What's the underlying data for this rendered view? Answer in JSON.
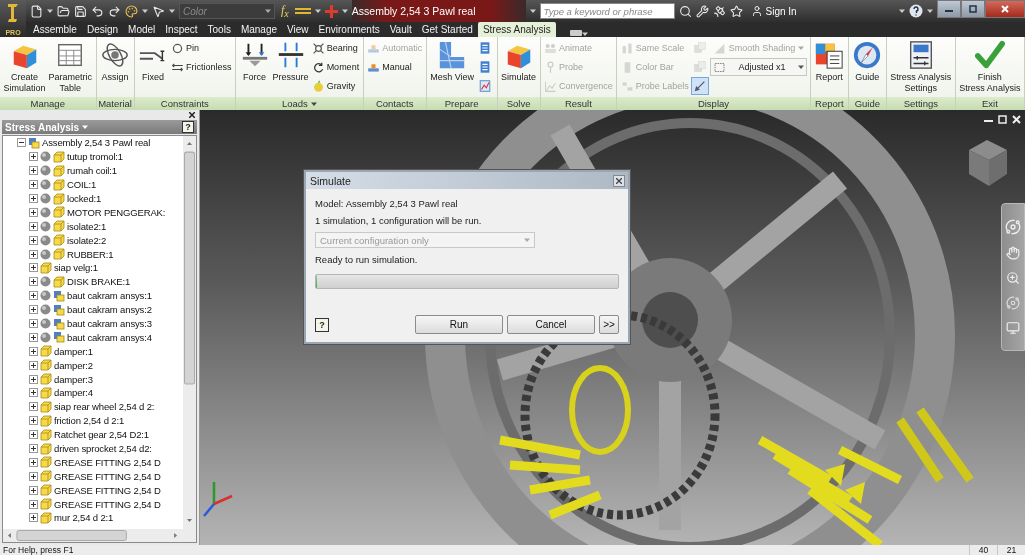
{
  "app_button": {
    "badge": "PRO"
  },
  "title_bar": {
    "style_value": "Color",
    "parameters_button": "f$_{x}$",
    "title": "Assembly 2,54 3 Pawl real",
    "search_placeholder": "Type a keyword or phrase",
    "sign_in": "Sign In"
  },
  "tabs": [
    {
      "label": "Assemble",
      "selected": false
    },
    {
      "label": "Design",
      "selected": false
    },
    {
      "label": "Model",
      "selected": false
    },
    {
      "label": "Inspect",
      "selected": false
    },
    {
      "label": "Tools",
      "selected": false
    },
    {
      "label": "Manage",
      "selected": false
    },
    {
      "label": "View",
      "selected": false
    },
    {
      "label": "Environments",
      "selected": false
    },
    {
      "label": "Vault",
      "selected": false
    },
    {
      "label": "Get Started",
      "selected": false
    },
    {
      "label": "Stress Analysis",
      "selected": true
    }
  ],
  "ribbon": {
    "panels": [
      {
        "label": "Manage",
        "menu": false,
        "columns": [
          [
            {
              "kind": "large",
              "label": "Create\nSimulation",
              "disabled": false
            }
          ],
          [
            {
              "kind": "large",
              "label": "Parametric\nTable",
              "disabled": false
            }
          ]
        ]
      },
      {
        "label": "Material",
        "menu": false,
        "columns": [
          [
            {
              "kind": "large",
              "label": "Assign",
              "disabled": false
            }
          ]
        ]
      },
      {
        "label": "Constraints",
        "menu": false,
        "columns": [
          [
            {
              "kind": "large",
              "label": "Fixed",
              "disabled": false
            }
          ],
          [
            {
              "kind": "small",
              "label": "Pin",
              "disabled": false
            },
            {
              "kind": "small",
              "label": "Frictionless",
              "disabled": false
            }
          ]
        ]
      },
      {
        "label": "Loads",
        "menu": true,
        "columns": [
          [
            {
              "kind": "large",
              "label": "Force",
              "disabled": false
            }
          ],
          [
            {
              "kind": "large",
              "label": "Pressure",
              "disabled": false
            }
          ],
          [
            {
              "kind": "small",
              "label": "Bearing",
              "disabled": false
            },
            {
              "kind": "small",
              "label": "Moment",
              "disabled": false
            },
            {
              "kind": "small",
              "label": "Gravity",
              "disabled": false
            }
          ]
        ]
      },
      {
        "label": "Contacts",
        "menu": false,
        "columns": [
          [
            {
              "kind": "small",
              "label": "Automatic",
              "disabled": true
            },
            {
              "kind": "small",
              "label": "Manual",
              "disabled": false
            }
          ]
        ]
      },
      {
        "label": "Prepare",
        "menu": false,
        "columns": [
          [
            {
              "kind": "large",
              "label": "Mesh View",
              "disabled": false
            }
          ],
          [
            {
              "kind": "icon",
              "selected": false,
              "disabled": false
            },
            {
              "kind": "icon",
              "selected": false,
              "disabled": false
            },
            {
              "kind": "icon",
              "selected": false,
              "disabled": false
            }
          ]
        ]
      },
      {
        "label": "Solve",
        "menu": false,
        "columns": [
          [
            {
              "kind": "large",
              "label": "Simulate",
              "disabled": false
            }
          ]
        ]
      },
      {
        "label": "Result",
        "menu": false,
        "columns": [
          [
            {
              "kind": "small",
              "label": "Animate",
              "disabled": true
            },
            {
              "kind": "small",
              "label": "Probe",
              "disabled": true
            },
            {
              "kind": "small",
              "label": "Convergence",
              "disabled": true
            }
          ]
        ]
      },
      {
        "label": "Display",
        "menu": false,
        "columns": [
          [
            {
              "kind": "small",
              "label": "Same Scale",
              "disabled": true
            },
            {
              "kind": "small",
              "label": "Color Bar",
              "disabled": true
            },
            {
              "kind": "small",
              "label": "Probe Labels",
              "disabled": true
            }
          ],
          [
            {
              "kind": "icon",
              "selected": false,
              "disabled": true
            },
            {
              "kind": "icon",
              "selected": false,
              "disabled": true
            },
            {
              "kind": "icon",
              "selected": true,
              "disabled": false
            }
          ],
          [
            {
              "kind": "select",
              "label": "Smooth Shading",
              "disabled": true
            },
            {
              "kind": "select",
              "label": "Adjusted x1",
              "disabled": false
            }
          ]
        ]
      },
      {
        "label": "Report",
        "menu": false,
        "columns": [
          [
            {
              "kind": "large",
              "label": "Report",
              "disabled": false
            }
          ]
        ]
      },
      {
        "label": "Guide",
        "menu": false,
        "columns": [
          [
            {
              "kind": "large",
              "label": "Guide",
              "disabled": false
            }
          ]
        ]
      },
      {
        "label": "Settings",
        "menu": false,
        "columns": [
          [
            {
              "kind": "large",
              "label": "Stress Analysis\nSettings",
              "disabled": false
            }
          ]
        ]
      },
      {
        "label": "Exit",
        "menu": false,
        "columns": [
          [
            {
              "kind": "large",
              "label": "Finish\nStress Analysis",
              "disabled": false
            }
          ]
        ]
      }
    ]
  },
  "browser": {
    "title": "Stress Analysis",
    "help": "?",
    "tree": {
      "label": "Assembly 2,54 3 Pawl real",
      "kind": "assembly",
      "expanded": true,
      "excluded": false,
      "children": [
        {
          "label": "tutup tromol:1",
          "kind": "part",
          "expanded": false,
          "excluded": true
        },
        {
          "label": "rumah coil:1",
          "kind": "part",
          "expanded": false,
          "excluded": true
        },
        {
          "label": "COIL:1",
          "kind": "part",
          "expanded": false,
          "excluded": true
        },
        {
          "label": "locked:1",
          "kind": "part",
          "expanded": false,
          "excluded": true
        },
        {
          "label": "MOTOR PENGGERAK:",
          "kind": "part",
          "expanded": false,
          "excluded": true
        },
        {
          "label": "isolate2:1",
          "kind": "part",
          "expanded": false,
          "excluded": true
        },
        {
          "label": "isolate2:2",
          "kind": "part",
          "expanded": false,
          "excluded": true
        },
        {
          "label": "RUBBER:1",
          "kind": "part",
          "expanded": false,
          "excluded": true
        },
        {
          "label": "siap velg:1",
          "kind": "part",
          "expanded": false,
          "excluded": false
        },
        {
          "label": "DISK BRAKE:1",
          "kind": "part",
          "expanded": false,
          "excluded": true
        },
        {
          "label": "baut cakram ansys:1",
          "kind": "assembly",
          "expanded": false,
          "excluded": true
        },
        {
          "label": "baut cakram ansys:2",
          "kind": "assembly",
          "expanded": false,
          "excluded": true
        },
        {
          "label": "baut cakram ansys:3",
          "kind": "assembly",
          "expanded": false,
          "excluded": true
        },
        {
          "label": "baut cakram ansys:4",
          "kind": "assembly",
          "expanded": false,
          "excluded": true
        },
        {
          "label": "damper:1",
          "kind": "part",
          "expanded": false,
          "excluded": false
        },
        {
          "label": "damper:2",
          "kind": "part",
          "expanded": false,
          "excluded": false
        },
        {
          "label": "damper:3",
          "kind": "part",
          "expanded": false,
          "excluded": false
        },
        {
          "label": "damper:4",
          "kind": "part",
          "expanded": false,
          "excluded": false
        },
        {
          "label": "siap rear wheel 2,54 d 2:",
          "kind": "part",
          "expanded": false,
          "excluded": false
        },
        {
          "label": "friction 2,54 d 2:1",
          "kind": "part",
          "expanded": false,
          "excluded": false
        },
        {
          "label": "Ratchet gear 2,54 D2:1",
          "kind": "part",
          "expanded": false,
          "excluded": false
        },
        {
          "label": "driven sprocket 2,54 d2:",
          "kind": "part",
          "expanded": false,
          "excluded": false
        },
        {
          "label": "GREASE FITTING 2,54 D",
          "kind": "part",
          "expanded": false,
          "excluded": false
        },
        {
          "label": "GREASE FITTING 2,54 D",
          "kind": "part",
          "expanded": false,
          "excluded": false
        },
        {
          "label": "GREASE FITTING 2,54 D",
          "kind": "part",
          "expanded": false,
          "excluded": false
        },
        {
          "label": "GREASE FITTING 2,54 D",
          "kind": "part",
          "expanded": false,
          "excluded": false
        },
        {
          "label": "mur 2,54 d 2:1",
          "kind": "part",
          "expanded": false,
          "excluded": false
        }
      ]
    }
  },
  "dialog": {
    "title": "Simulate",
    "model": "Model: Assembly 2,54 3 Pawl real",
    "summary": "1 simulation, 1 configuration will be run.",
    "configuration": {
      "value": "Current configuration only",
      "disabled": true
    },
    "status": "Ready to run simulation.",
    "progress": {
      "level": 0
    },
    "help": "?",
    "buttons": [
      "Run",
      "Cancel",
      ">>"
    ]
  },
  "status_bar": {
    "help": "For Help, press F1",
    "values": [
      "40",
      "21"
    ]
  }
}
